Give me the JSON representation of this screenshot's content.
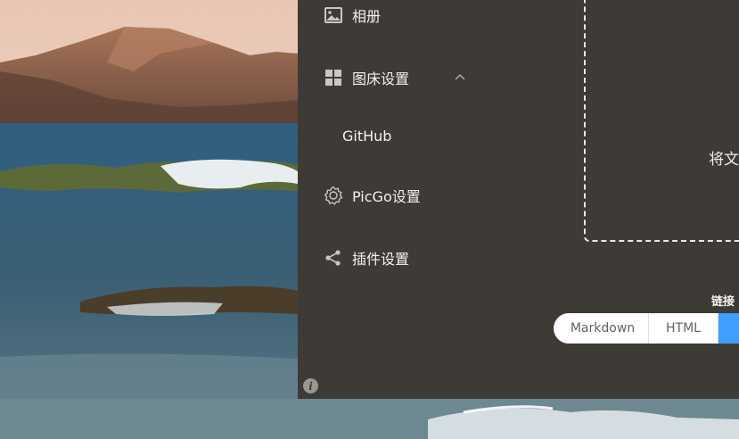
{
  "nav": {
    "album_label": "相册",
    "picbed_settings_label": "图床设置",
    "github_label": "GitHub",
    "picgo_settings_label": "PicGo设置",
    "plugin_settings_label": "插件设置"
  },
  "upload": {
    "drop_text": "将文",
    "link_format_label": "链接"
  },
  "link_formats": {
    "markdown_label": "Markdown",
    "html_label": "HTML",
    "active_label": ""
  },
  "icons": {
    "album": "image-icon",
    "picbed": "grid-icon",
    "picbed_expand": "chevron-up-icon",
    "picgo": "gear-icon",
    "plugin": "share-icon",
    "info": "info-icon"
  },
  "colors": {
    "app_background": "#3e3a36",
    "accent": "#409eff",
    "text": "#f2f2f2"
  }
}
